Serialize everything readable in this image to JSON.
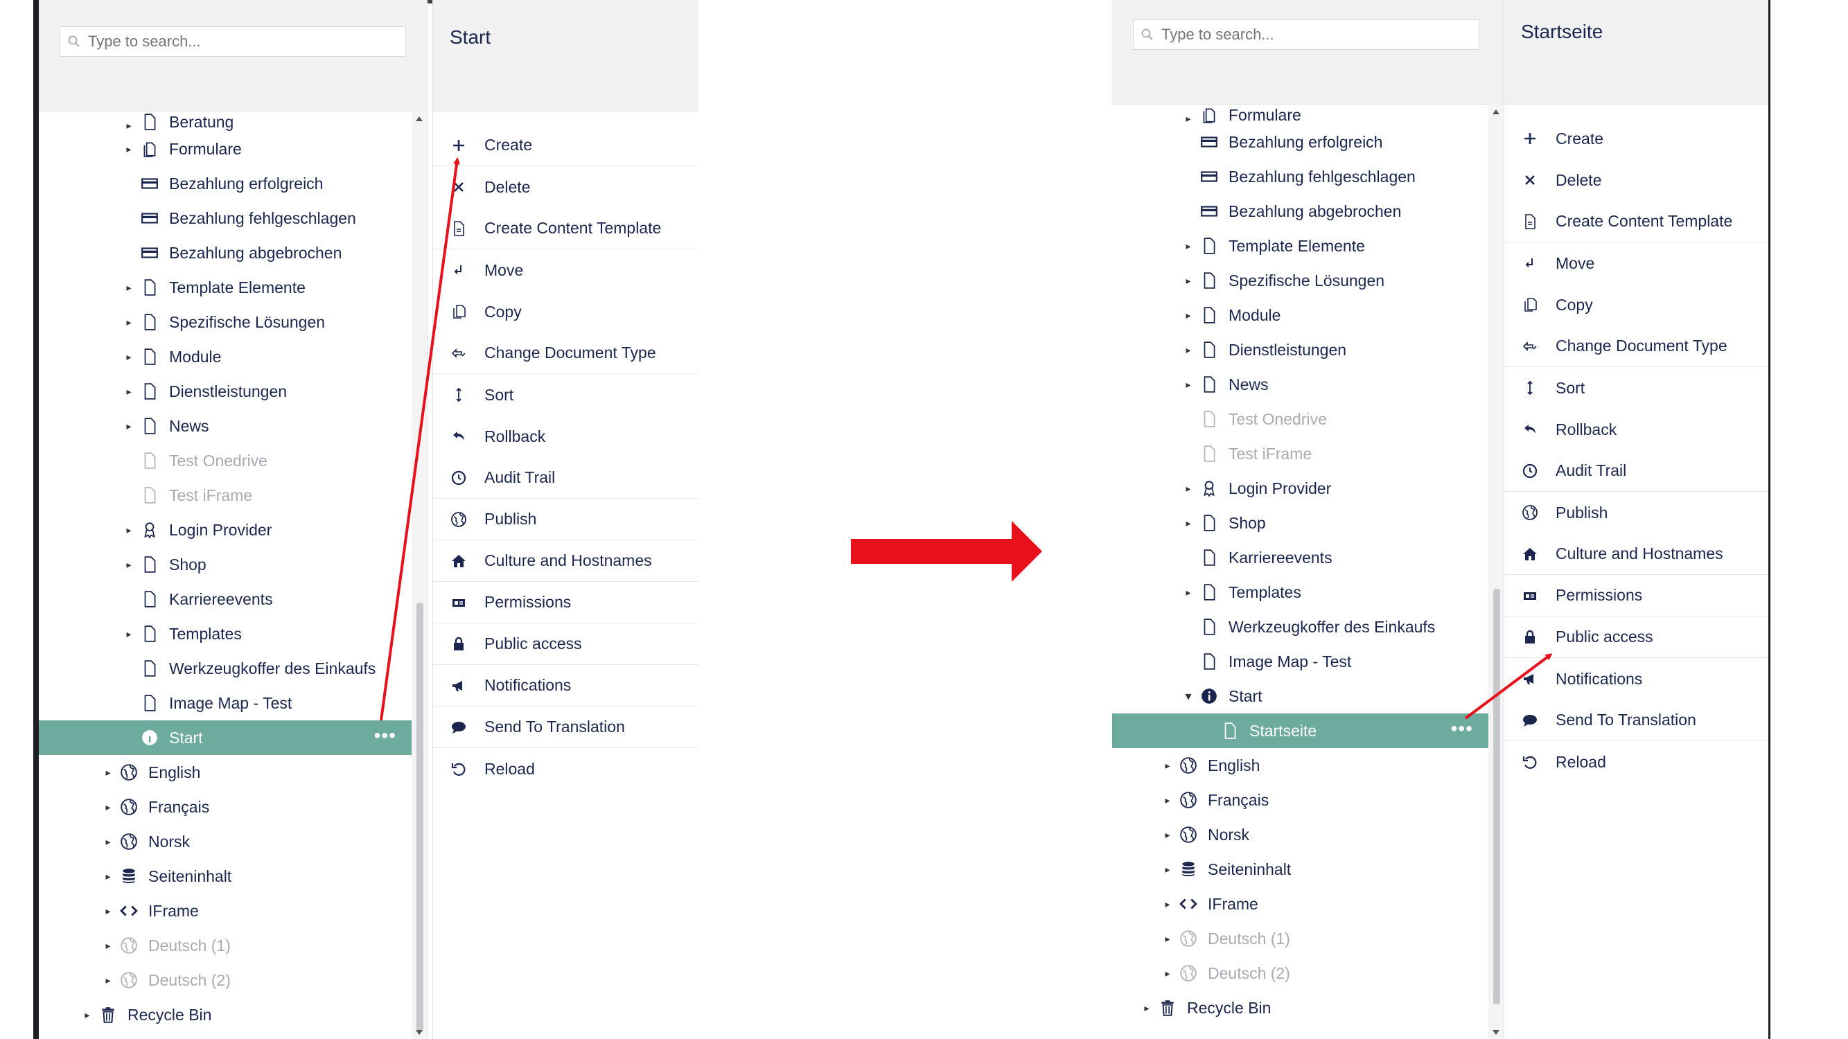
{
  "left": {
    "search": {
      "placeholder": "Type to search..."
    },
    "header_title": "Start",
    "tree": [
      {
        "label": "Beratung",
        "icon": "document-icon",
        "caret": true,
        "muted": false,
        "indent": 2,
        "partial": true
      },
      {
        "label": "Formulare",
        "icon": "documents-icon",
        "caret": true,
        "muted": false,
        "indent": 2
      },
      {
        "label": "Bezahlung erfolgreich",
        "icon": "credit-card-icon",
        "caret": false,
        "muted": false,
        "indent": 2
      },
      {
        "label": "Bezahlung fehlgeschlagen",
        "icon": "credit-card-icon",
        "caret": false,
        "muted": false,
        "indent": 2
      },
      {
        "label": "Bezahlung abgebrochen",
        "icon": "credit-card-icon",
        "caret": false,
        "muted": false,
        "indent": 2
      },
      {
        "label": "Template Elemente",
        "icon": "document-icon",
        "caret": true,
        "muted": false,
        "indent": 2
      },
      {
        "label": "Spezifische Lösungen",
        "icon": "document-icon",
        "caret": true,
        "muted": false,
        "indent": 2
      },
      {
        "label": "Module",
        "icon": "document-icon",
        "caret": true,
        "muted": false,
        "indent": 2
      },
      {
        "label": "Dienstleistungen",
        "icon": "document-icon",
        "caret": true,
        "muted": false,
        "indent": 2
      },
      {
        "label": "News",
        "icon": "document-icon",
        "caret": true,
        "muted": false,
        "indent": 2
      },
      {
        "label": "Test Onedrive",
        "icon": "document-icon",
        "caret": false,
        "muted": true,
        "indent": 2
      },
      {
        "label": "Test iFrame",
        "icon": "document-icon",
        "caret": false,
        "muted": true,
        "indent": 2
      },
      {
        "label": "Login Provider",
        "icon": "award-icon",
        "caret": true,
        "muted": false,
        "indent": 2
      },
      {
        "label": "Shop",
        "icon": "document-icon",
        "caret": true,
        "muted": false,
        "indent": 2
      },
      {
        "label": "Karriereevents",
        "icon": "document-icon",
        "caret": false,
        "muted": false,
        "indent": 2
      },
      {
        "label": "Templates",
        "icon": "document-icon",
        "caret": true,
        "muted": false,
        "indent": 2
      },
      {
        "label": "Werkzeugkoffer des Einkaufs",
        "icon": "document-icon",
        "caret": false,
        "muted": false,
        "indent": 2
      },
      {
        "label": "Image Map - Test",
        "icon": "document-icon",
        "caret": false,
        "muted": false,
        "indent": 2
      },
      {
        "label": "Start",
        "icon": "info-icon",
        "caret": false,
        "muted": false,
        "indent": 2,
        "selected": true
      },
      {
        "label": "English",
        "icon": "globe-icon",
        "caret": true,
        "muted": false,
        "indent": 1
      },
      {
        "label": "Français",
        "icon": "globe-icon",
        "caret": true,
        "muted": false,
        "indent": 1
      },
      {
        "label": "Norsk",
        "icon": "globe-icon",
        "caret": true,
        "muted": false,
        "indent": 1
      },
      {
        "label": "Seiteninhalt",
        "icon": "database-icon",
        "caret": true,
        "muted": false,
        "indent": 1
      },
      {
        "label": "IFrame",
        "icon": "code-icon",
        "caret": true,
        "muted": false,
        "indent": 1
      },
      {
        "label": "Deutsch (1)",
        "icon": "globe-icon",
        "caret": true,
        "muted": true,
        "indent": 1
      },
      {
        "label": "Deutsch (2)",
        "icon": "globe-icon",
        "caret": true,
        "muted": true,
        "indent": 1
      },
      {
        "label": "Recycle Bin",
        "icon": "trash-icon",
        "caret": true,
        "muted": false,
        "indent": 0
      }
    ],
    "menu": [
      {
        "label": "Create",
        "icon": "plus-icon",
        "sep": true
      },
      {
        "label": "Delete",
        "icon": "x-icon",
        "sep": false
      },
      {
        "label": "Create Content Template",
        "icon": "template-icon",
        "sep": true
      },
      {
        "label": "Move",
        "icon": "move-icon",
        "sep": false
      },
      {
        "label": "Copy",
        "icon": "copy-icon",
        "sep": false
      },
      {
        "label": "Change Document Type",
        "icon": "change-type-icon",
        "sep": true
      },
      {
        "label": "Sort",
        "icon": "sort-icon",
        "sep": false
      },
      {
        "label": "Rollback",
        "icon": "rollback-icon",
        "sep": false
      },
      {
        "label": "Audit Trail",
        "icon": "clock-icon",
        "sep": true
      },
      {
        "label": "Publish",
        "icon": "globe-icon",
        "sep": true
      },
      {
        "label": "Culture and Hostnames",
        "icon": "home-icon",
        "sep": true
      },
      {
        "label": "Permissions",
        "icon": "permissions-icon",
        "sep": true
      },
      {
        "label": "Public access",
        "icon": "lock-icon",
        "sep": true
      },
      {
        "label": "Notifications",
        "icon": "megaphone-icon",
        "sep": true
      },
      {
        "label": "Send To Translation",
        "icon": "chat-icon",
        "sep": true
      },
      {
        "label": "Reload",
        "icon": "reload-icon",
        "sep": false
      }
    ]
  },
  "right": {
    "search": {
      "placeholder": "Type to search..."
    },
    "header_title": "Startseite",
    "tree": [
      {
        "label": "Formulare",
        "icon": "documents-icon",
        "caret": true,
        "muted": false,
        "indent": 2,
        "partial": true
      },
      {
        "label": "Bezahlung erfolgreich",
        "icon": "credit-card-icon",
        "caret": false,
        "muted": false,
        "indent": 2
      },
      {
        "label": "Bezahlung fehlgeschlagen",
        "icon": "credit-card-icon",
        "caret": false,
        "muted": false,
        "indent": 2
      },
      {
        "label": "Bezahlung abgebrochen",
        "icon": "credit-card-icon",
        "caret": false,
        "muted": false,
        "indent": 2
      },
      {
        "label": "Template Elemente",
        "icon": "document-icon",
        "caret": true,
        "muted": false,
        "indent": 2
      },
      {
        "label": "Spezifische Lösungen",
        "icon": "document-icon",
        "caret": true,
        "muted": false,
        "indent": 2
      },
      {
        "label": "Module",
        "icon": "document-icon",
        "caret": true,
        "muted": false,
        "indent": 2
      },
      {
        "label": "Dienstleistungen",
        "icon": "document-icon",
        "caret": true,
        "muted": false,
        "indent": 2
      },
      {
        "label": "News",
        "icon": "document-icon",
        "caret": true,
        "muted": false,
        "indent": 2
      },
      {
        "label": "Test Onedrive",
        "icon": "document-icon",
        "caret": false,
        "muted": true,
        "indent": 2
      },
      {
        "label": "Test iFrame",
        "icon": "document-icon",
        "caret": false,
        "muted": true,
        "indent": 2
      },
      {
        "label": "Login Provider",
        "icon": "award-icon",
        "caret": true,
        "muted": false,
        "indent": 2
      },
      {
        "label": "Shop",
        "icon": "document-icon",
        "caret": true,
        "muted": false,
        "indent": 2
      },
      {
        "label": "Karriereevents",
        "icon": "document-icon",
        "caret": false,
        "muted": false,
        "indent": 2
      },
      {
        "label": "Templates",
        "icon": "document-icon",
        "caret": true,
        "muted": false,
        "indent": 2
      },
      {
        "label": "Werkzeugkoffer des Einkaufs",
        "icon": "document-icon",
        "caret": false,
        "muted": false,
        "indent": 2
      },
      {
        "label": "Image Map - Test",
        "icon": "document-icon",
        "caret": false,
        "muted": false,
        "indent": 2
      },
      {
        "label": "Start",
        "icon": "info-icon",
        "caret": true,
        "expanded": true,
        "muted": false,
        "indent": 2
      },
      {
        "label": "Startseite",
        "icon": "document-icon",
        "caret": false,
        "muted": false,
        "indent": 3,
        "selected": true
      },
      {
        "label": "English",
        "icon": "globe-icon",
        "caret": true,
        "muted": false,
        "indent": 1
      },
      {
        "label": "Français",
        "icon": "globe-icon",
        "caret": true,
        "muted": false,
        "indent": 1
      },
      {
        "label": "Norsk",
        "icon": "globe-icon",
        "caret": true,
        "muted": false,
        "indent": 1
      },
      {
        "label": "Seiteninhalt",
        "icon": "database-icon",
        "caret": true,
        "muted": false,
        "indent": 1
      },
      {
        "label": "IFrame",
        "icon": "code-icon",
        "caret": true,
        "muted": false,
        "indent": 1
      },
      {
        "label": "Deutsch (1)",
        "icon": "globe-icon",
        "caret": true,
        "muted": true,
        "indent": 1
      },
      {
        "label": "Deutsch (2)",
        "icon": "globe-icon",
        "caret": true,
        "muted": true,
        "indent": 1
      },
      {
        "label": "Recycle Bin",
        "icon": "trash-icon",
        "caret": true,
        "muted": false,
        "indent": 0
      }
    ],
    "menu": [
      {
        "label": "Create",
        "icon": "plus-icon",
        "sep": false
      },
      {
        "label": "Delete",
        "icon": "x-icon",
        "sep": false
      },
      {
        "label": "Create Content Template",
        "icon": "template-icon",
        "sep": true
      },
      {
        "label": "Move",
        "icon": "move-icon",
        "sep": false
      },
      {
        "label": "Copy",
        "icon": "copy-icon",
        "sep": false
      },
      {
        "label": "Change Document Type",
        "icon": "change-type-icon",
        "sep": true
      },
      {
        "label": "Sort",
        "icon": "sort-icon",
        "sep": false
      },
      {
        "label": "Rollback",
        "icon": "rollback-icon",
        "sep": false
      },
      {
        "label": "Audit Trail",
        "icon": "clock-icon",
        "sep": true
      },
      {
        "label": "Publish",
        "icon": "globe-icon",
        "sep": false
      },
      {
        "label": "Culture and Hostnames",
        "icon": "home-icon",
        "sep": true
      },
      {
        "label": "Permissions",
        "icon": "permissions-icon",
        "sep": true
      },
      {
        "label": "Public access",
        "icon": "lock-icon",
        "sep": true
      },
      {
        "label": "Notifications",
        "icon": "megaphone-icon",
        "sep": false
      },
      {
        "label": "Send To Translation",
        "icon": "chat-icon",
        "sep": true
      },
      {
        "label": "Reload",
        "icon": "reload-icon",
        "sep": false
      }
    ]
  },
  "selected_dots": "•••",
  "colors": {
    "selected_row": "#6dab9e",
    "text": "#1b264f",
    "muted_text": "#a9a9b0",
    "annotation_arrow": "#e8101a"
  }
}
